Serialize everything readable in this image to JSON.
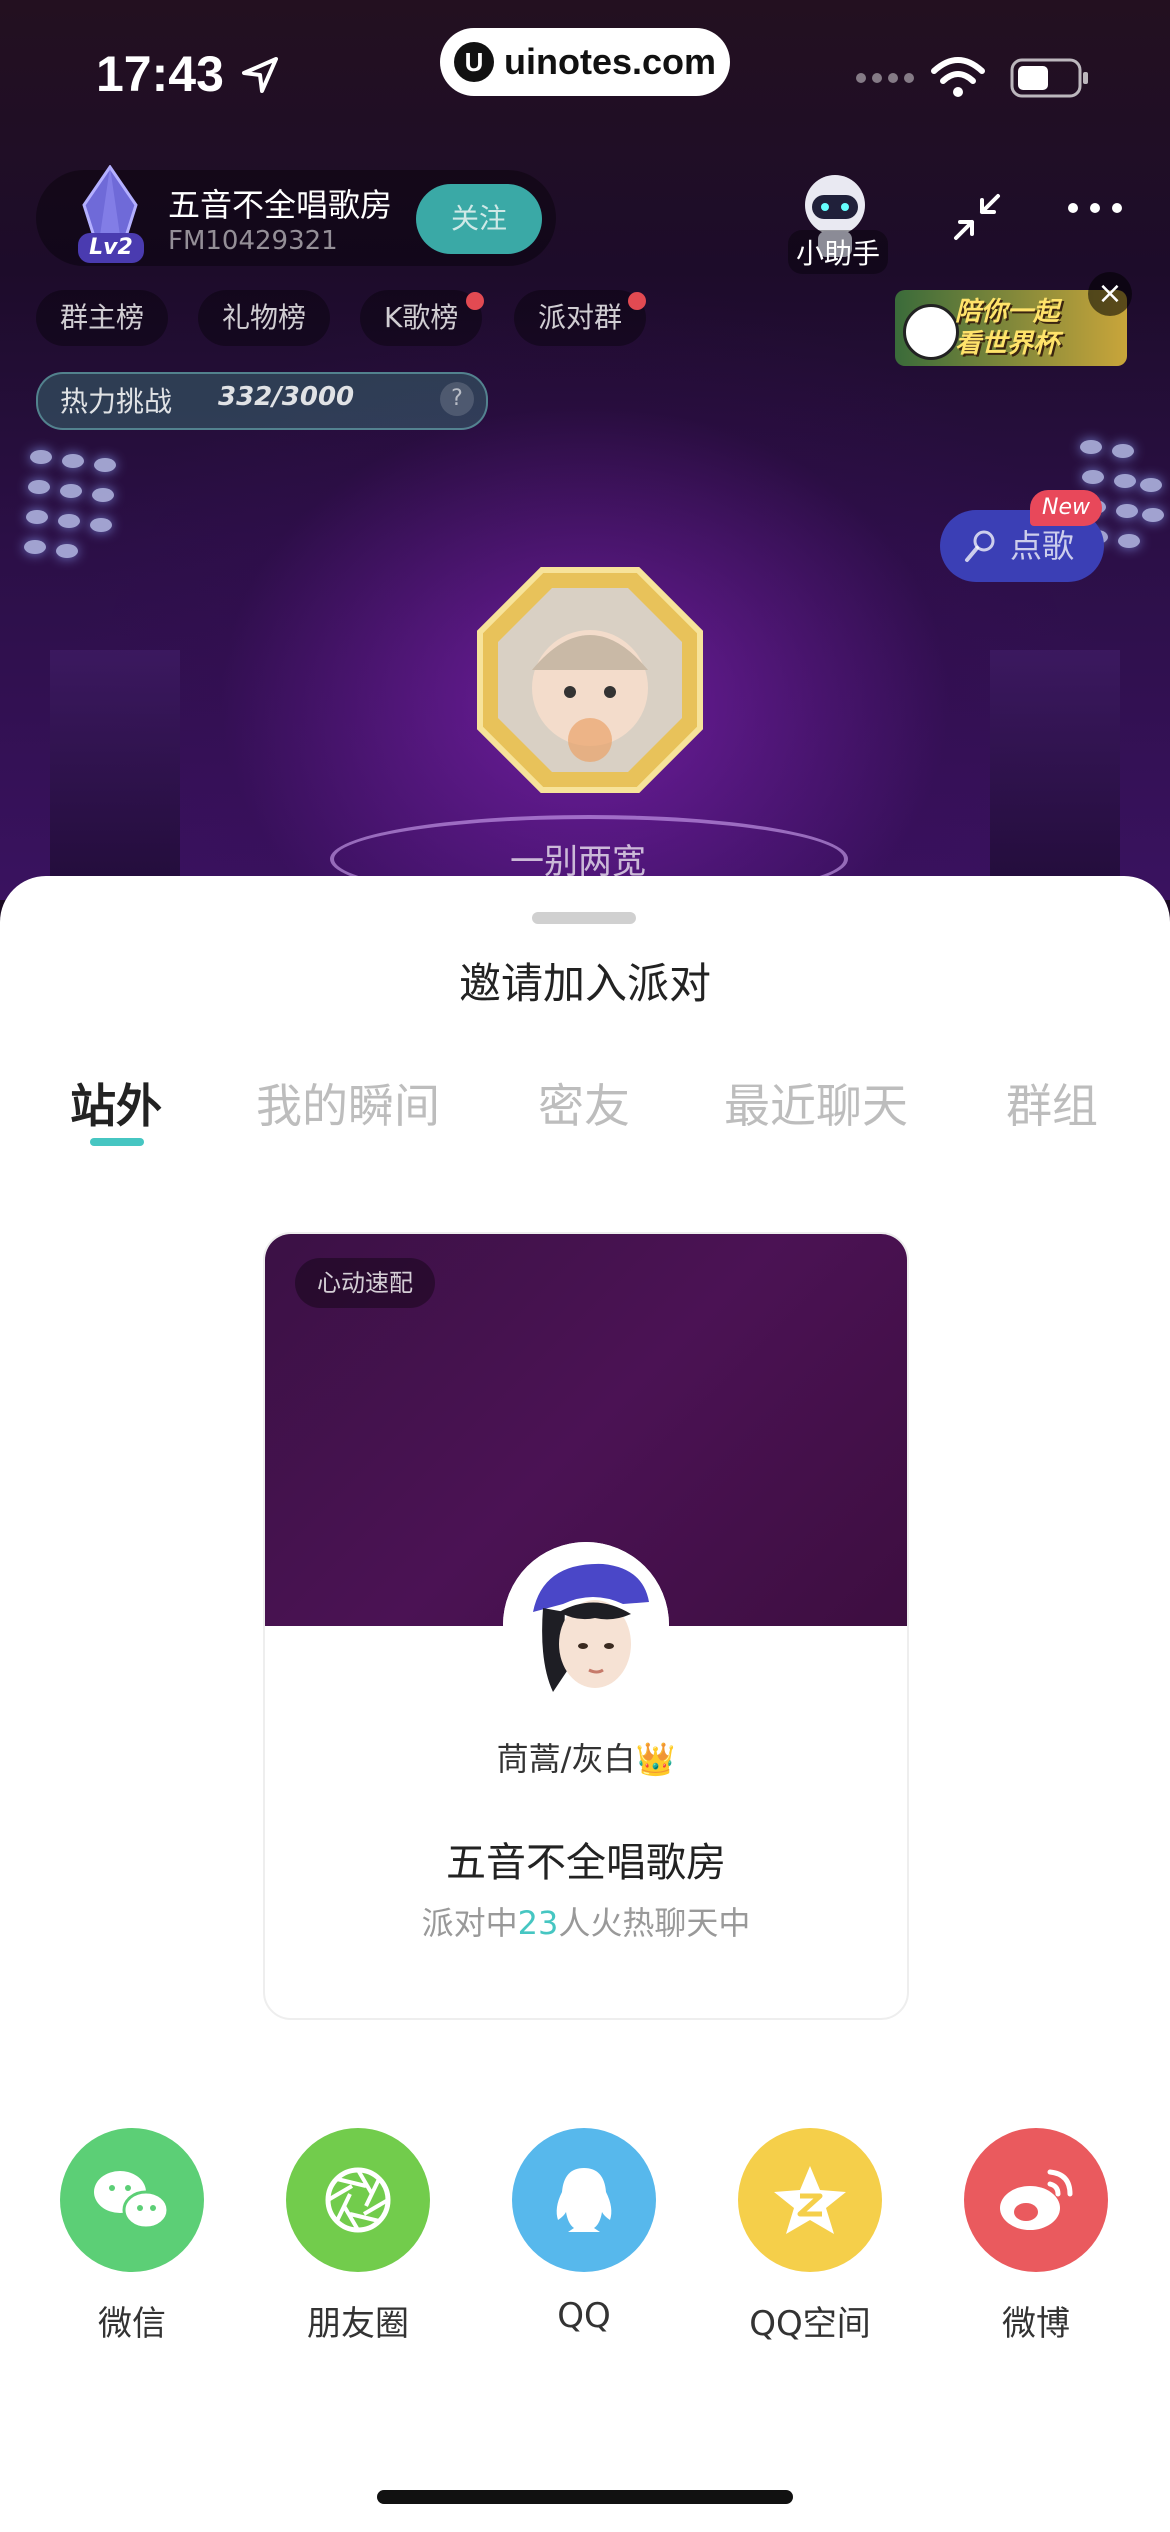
{
  "status_bar": {
    "time": "17:43",
    "watermark": "uinotes.com",
    "watermark_logo": "U"
  },
  "room": {
    "title": "五音不全唱歌房",
    "id": "FM10429321",
    "level": "Lv2",
    "follow_label": "关注",
    "assistant_label": "小助手",
    "tags": [
      "群主榜",
      "礼物榜",
      "K歌榜",
      "派对群"
    ],
    "heat": {
      "label": "热力挑战",
      "value": "332/3000",
      "help": "?"
    },
    "banner_text_line1": "陪你一起",
    "banner_text_line2": "看世界杯",
    "song_label": "点歌",
    "new_badge": "New",
    "seat_name": "一别两宽"
  },
  "sheet": {
    "title": "邀请加入派对",
    "tabs": [
      "站外",
      "我的瞬间",
      "密友",
      "最近聊天",
      "群组"
    ],
    "active_tab": 0,
    "card": {
      "tag": "心动速配",
      "host_name": "茼蒿/灰白👑",
      "room_title": "五音不全唱歌房",
      "sub_prefix": "派对中",
      "sub_count": "23",
      "sub_suffix": "人火热聊天中"
    },
    "share": [
      {
        "label": "微信",
        "icon": "wechat-icon",
        "color": "#5ccf76"
      },
      {
        "label": "朋友圈",
        "icon": "moments-icon",
        "color": "#72cc4c"
      },
      {
        "label": "QQ",
        "icon": "qq-icon",
        "color": "#57b8ec"
      },
      {
        "label": "QQ空间",
        "icon": "qzone-icon",
        "color": "#f5cf4a"
      },
      {
        "label": "微博",
        "icon": "weibo-icon",
        "color": "#ea5a5e"
      }
    ]
  },
  "colors": {
    "accent": "#46c6c2",
    "follow": "#3aa9a6",
    "badge_red": "#e24a52"
  }
}
